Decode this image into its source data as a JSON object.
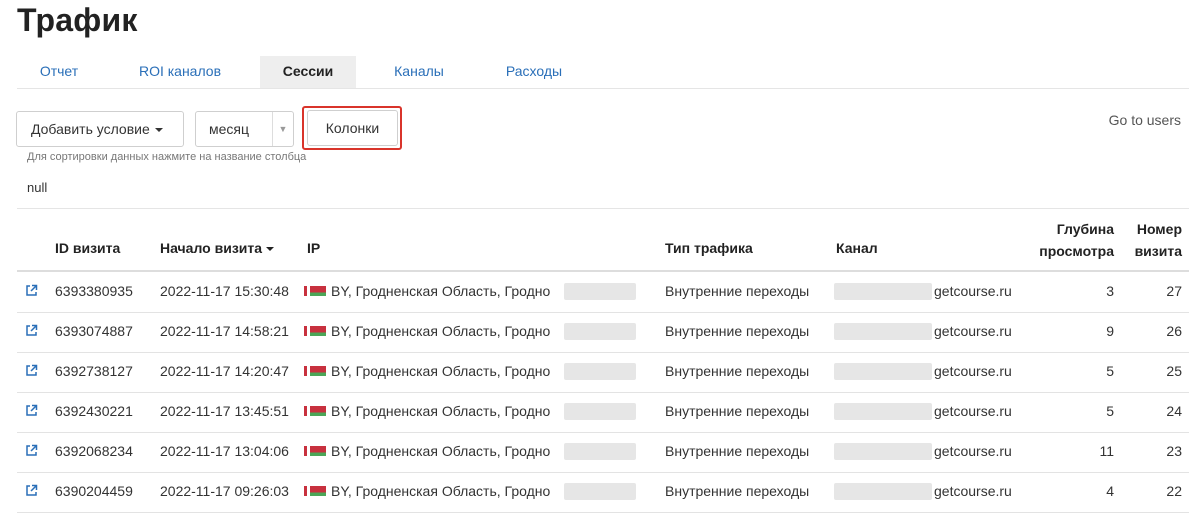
{
  "title": "Трафик",
  "tabs": [
    {
      "label": "Отчет",
      "active": false
    },
    {
      "label": "ROI каналов",
      "active": false
    },
    {
      "label": "Сессии",
      "active": true
    },
    {
      "label": "Каналы",
      "active": false
    },
    {
      "label": "Расходы",
      "active": false
    }
  ],
  "toolbar": {
    "add_condition": "Добавить условие",
    "period_value": "месяц",
    "columns_button": "Колонки",
    "go_to_users": "Go to users"
  },
  "hint": "Для сортировки данных нажмите на название столбца",
  "null_text": "null",
  "table": {
    "headers": {
      "id": "ID визита",
      "start": "Начало визита",
      "ip": "IP",
      "traffic_type": "Тип трафика",
      "channel": "Канал",
      "depth_1": "Глубина",
      "depth_2": "просмотра",
      "visit_num_1": "Номер",
      "visit_num_2": "визита"
    },
    "rows": [
      {
        "id": "6393380935",
        "start": "2022-11-17 15:30:48",
        "ip": "BY, Гродненская Область, Гродно",
        "traffic_type": "Внутренние переходы",
        "channel": "getcourse.ru",
        "depth": "3",
        "visit_num": "27"
      },
      {
        "id": "6393074887",
        "start": "2022-11-17 14:58:21",
        "ip": "BY, Гродненская Область, Гродно",
        "traffic_type": "Внутренние переходы",
        "channel": "getcourse.ru",
        "depth": "9",
        "visit_num": "26"
      },
      {
        "id": "6392738127",
        "start": "2022-11-17 14:20:47",
        "ip": "BY, Гродненская Область, Гродно",
        "traffic_type": "Внутренние переходы",
        "channel": "getcourse.ru",
        "depth": "5",
        "visit_num": "25"
      },
      {
        "id": "6392430221",
        "start": "2022-11-17 13:45:51",
        "ip": "BY, Гродненская Область, Гродно",
        "traffic_type": "Внутренние переходы",
        "channel": "getcourse.ru",
        "depth": "5",
        "visit_num": "24"
      },
      {
        "id": "6392068234",
        "start": "2022-11-17 13:04:06",
        "ip": "BY, Гродненская Область, Гродно",
        "traffic_type": "Внутренние переходы",
        "channel": "getcourse.ru",
        "depth": "11",
        "visit_num": "23"
      },
      {
        "id": "6390204459",
        "start": "2022-11-17 09:26:03",
        "ip": "BY, Гродненская Область, Гродно",
        "traffic_type": "Внутренние переходы",
        "channel": "getcourse.ru",
        "depth": "4",
        "visit_num": "22"
      }
    ]
  },
  "colors": {
    "link": "#2a6fb8",
    "highlight": "#d9342b",
    "flag_red": "#c8313e",
    "flag_green": "#4aa657"
  }
}
